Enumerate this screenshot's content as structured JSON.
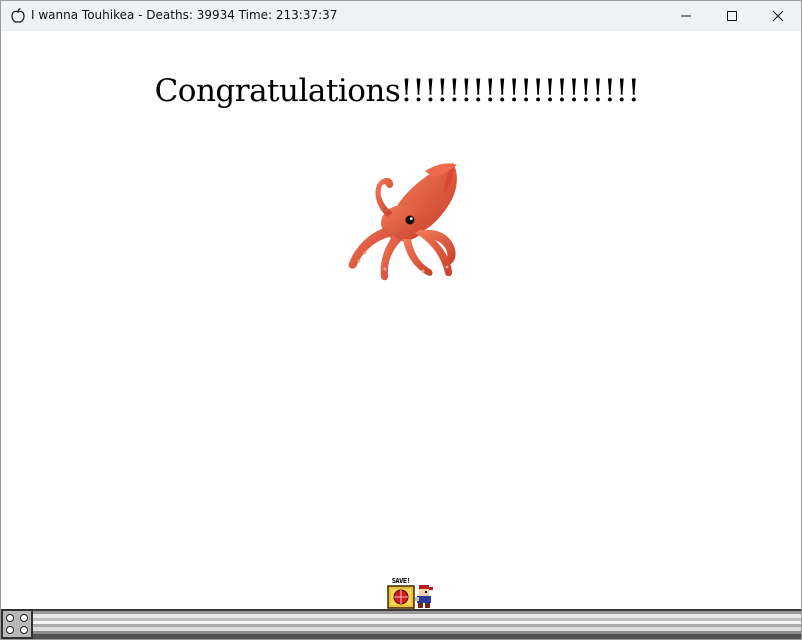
{
  "window": {
    "title": "I wanna Touhikea - Deaths: 39934 Time: 213:37:37",
    "app_icon": "apple-outline-icon",
    "controls": {
      "minimize_icon": "minimize-icon",
      "maximize_icon": "maximize-icon",
      "close_icon": "close-icon"
    }
  },
  "game": {
    "message": "Congratulations!!!!!!!!!!!!!!!!!!!!",
    "emoji": "squid-emoji",
    "save_point": {
      "label": "SAVE!",
      "icon": "save-point-icon"
    },
    "player": "the-kid-sprite"
  },
  "colors": {
    "titlebar": "#eef2f8",
    "background": "#ffffff",
    "squid": "#e8573a"
  }
}
